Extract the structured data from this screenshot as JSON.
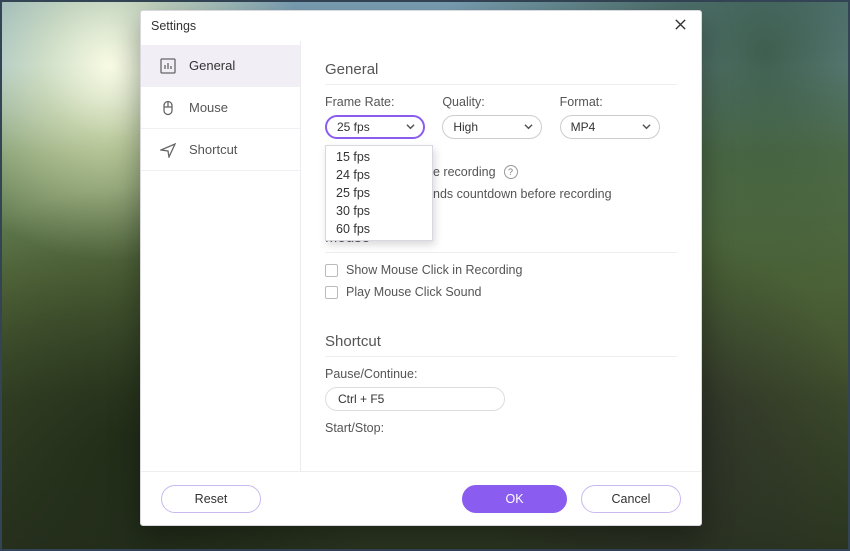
{
  "window": {
    "title": "Settings"
  },
  "sidebar": {
    "items": [
      {
        "label": "General"
      },
      {
        "label": "Mouse"
      },
      {
        "label": "Shortcut"
      }
    ]
  },
  "sections": {
    "general": {
      "title": "General",
      "frame_rate_label": "Frame Rate:",
      "frame_rate_value": "25 fps",
      "frame_rate_options": [
        "15 fps",
        "24 fps",
        "25 fps",
        "30 fps",
        "60 fps"
      ],
      "quality_label": "Quality:",
      "quality_value": "High",
      "format_label": "Format:",
      "format_value": "MP4",
      "hide_while_recording_partial": "e recording",
      "countdown_partial": "nds countdown before recording"
    },
    "mouse": {
      "title": "Mouse",
      "show_click": "Show Mouse Click in Recording",
      "play_sound": "Play Mouse Click Sound"
    },
    "shortcut": {
      "title": "Shortcut",
      "pause_label": "Pause/Continue:",
      "pause_value": "Ctrl + F5",
      "startstop_label": "Start/Stop:"
    }
  },
  "footer": {
    "reset": "Reset",
    "ok": "OK",
    "cancel": "Cancel"
  }
}
